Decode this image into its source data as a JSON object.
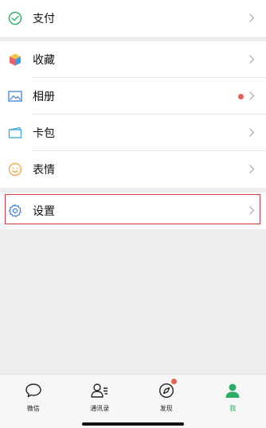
{
  "menu": {
    "pay": {
      "label": "支付"
    },
    "favorites": {
      "label": "收藏"
    },
    "album": {
      "label": "相册"
    },
    "cards": {
      "label": "卡包"
    },
    "stickers": {
      "label": "表情"
    },
    "settings": {
      "label": "设置"
    }
  },
  "tabbar": {
    "chats": "微信",
    "contacts": "通讯录",
    "discover": "发现",
    "me": "我"
  },
  "colors": {
    "accent_green": "#2aae67",
    "badge_red": "#e9604f",
    "highlight_border": "#d33a3a"
  }
}
